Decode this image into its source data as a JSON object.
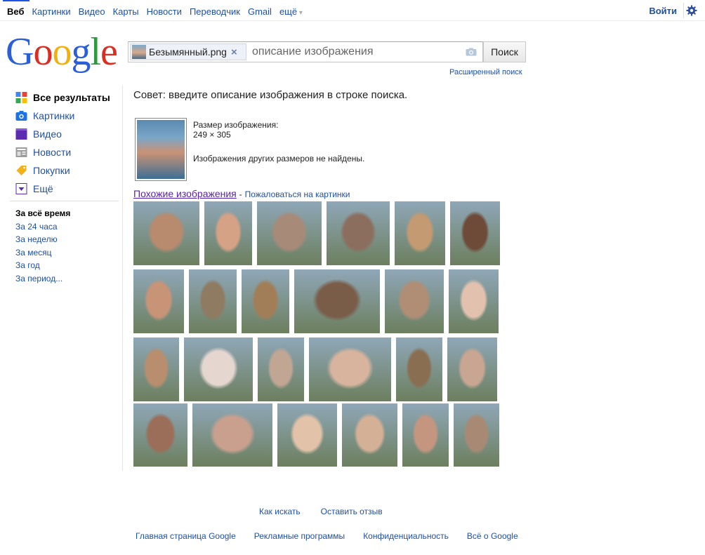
{
  "topnav": {
    "items": [
      "Веб",
      "Картинки",
      "Видео",
      "Карты",
      "Новости",
      "Переводчик",
      "Gmail",
      "ещё"
    ],
    "signin": "Войти"
  },
  "logo": "Google",
  "search": {
    "file_chip": "Безымянный.png",
    "chip_close": "×",
    "placeholder": "описание изображения",
    "button": "Поиск",
    "advanced": "Расширенный поиск"
  },
  "leftnav": {
    "items": [
      {
        "label": "Все результаты",
        "icon": "all-results-icon",
        "color": "#4285f4"
      },
      {
        "label": "Картинки",
        "icon": "images-camera-icon",
        "color": "#1a73e8"
      },
      {
        "label": "Видео",
        "icon": "video-clapper-icon",
        "color": "#5b2bb0"
      },
      {
        "label": "Новости",
        "icon": "news-icon",
        "color": "#888888"
      },
      {
        "label": "Покупки",
        "icon": "shopping-tag-icon",
        "color": "#f2b01a"
      },
      {
        "label": "Ещё",
        "icon": "more-dropdown-icon",
        "color": "#5b2bb0"
      }
    ],
    "time": [
      "За всё время",
      "За 24 часа",
      "За неделю",
      "За месяц",
      "За год",
      "За период..."
    ]
  },
  "main": {
    "tip": "Совет: введите описание изображения в строке поиска.",
    "size_label": "Размер изображения:",
    "size_value": "249 × 305",
    "not_found": "Изображения других размеров не найдены.",
    "similar_link": "Похожие изображения",
    "separator": "-",
    "report_link": "Пожаловаться на картинки"
  },
  "results": [
    [
      "#b88a6e",
      "#d6a285",
      "#a88a78",
      "#8c6e5e",
      "#c49a72",
      "#6e4a38"
    ],
    [
      "#c89478",
      "#8f7a62",
      "#a27e58",
      "#7a5d48",
      "#b08e76",
      "#e2c2ae"
    ],
    [
      "#b88e6e",
      "#e6d6d0",
      "#c2a694",
      "#d8b49e",
      "#8a6e52",
      "#c9a692"
    ],
    [
      "#9a6e58",
      "#c9a08e",
      "#e2c2a8",
      "#d4b096",
      "#c49680",
      "#a88a74"
    ]
  ],
  "footer": {
    "row1": [
      "Как искать",
      "Оставить отзыв"
    ],
    "row2": [
      "Главная страница Google",
      "Рекламные программы",
      "Конфиденциальность",
      "Всё о Google"
    ]
  }
}
